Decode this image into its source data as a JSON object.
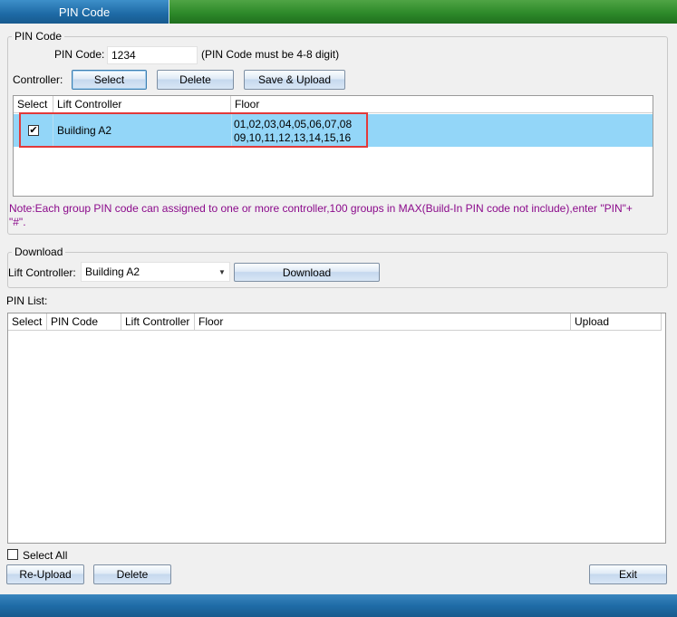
{
  "tabs": [
    {
      "label": "PIN Code"
    }
  ],
  "pin_group": {
    "title": "PIN Code",
    "pin_label": "PIN Code:",
    "pin_value": "1234",
    "pin_hint": "(PIN Code must be 4-8 digit)",
    "controller_label": "Controller:",
    "buttons": {
      "select": "Select",
      "delete": "Delete",
      "save_upload": "Save & Upload"
    },
    "table": {
      "columns": [
        "Select",
        "Lift Controller",
        "Floor"
      ],
      "rows": [
        {
          "checked": true,
          "check_glyph": "✔",
          "controller": "Building A2",
          "floor_line1": "01,02,03,04,05,06,07,08",
          "floor_line2": "09,10,11,12,13,14,15,16"
        }
      ]
    },
    "note_line1": "Note:Each group PIN code can assigned to one or more controller,100 groups in MAX(Build-In PIN code not include),enter \"PIN\"+",
    "note_line2": "\"#\"."
  },
  "download_group": {
    "title": "Download",
    "lift_label": "Lift Controller:",
    "lift_value": "Building A2",
    "download_button": "Download"
  },
  "pin_list": {
    "label": "PIN List:",
    "columns": [
      "Select",
      "PIN Code",
      "Lift Controller",
      "Floor",
      "Upload"
    ]
  },
  "footer": {
    "select_all": "Select All",
    "reupload": "Re-Upload",
    "delete": "Delete",
    "exit": "Exit"
  },
  "colors": {
    "selected_row": "#93d6f8",
    "highlight": "#e23a3a",
    "note": "#8b0a8b"
  }
}
